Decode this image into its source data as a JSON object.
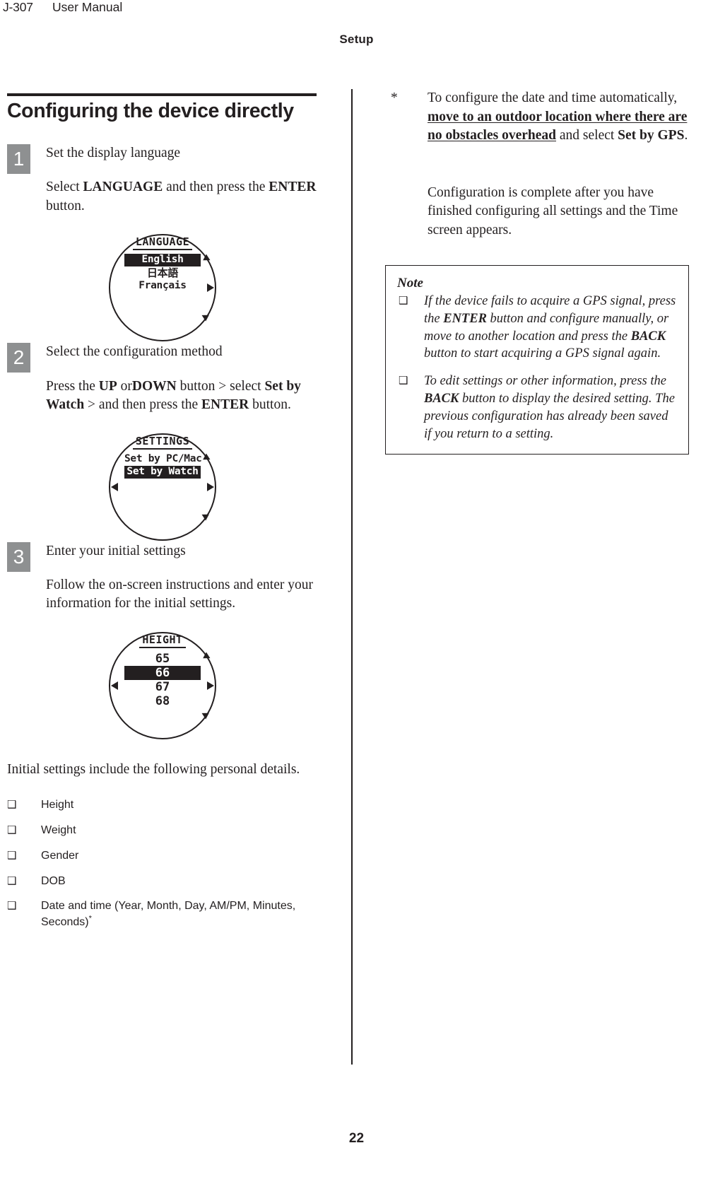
{
  "running_head": {
    "model": "J-307",
    "manual_title": "User Manual"
  },
  "section_title": "Setup",
  "page_number": "22",
  "left_column": {
    "headline": "Configuring the device directly",
    "steps": [
      {
        "number": "1",
        "title": "Set the display language",
        "body_parts": [
          {
            "text": "Select ",
            "style": "normal"
          },
          {
            "text": "LANGUAGE",
            "style": "bold"
          },
          {
            "text": " and then press the ",
            "style": "normal"
          },
          {
            "text": "ENTER",
            "style": "bold"
          },
          {
            "text": " button.",
            "style": "normal"
          }
        ],
        "screen": {
          "name": "language-screen",
          "title": "LANGUAGE",
          "rows": [
            {
              "label": "English",
              "selected": true,
              "script": "latin"
            },
            {
              "label": "日本語",
              "selected": false,
              "script": "cjk"
            },
            {
              "label": "Français",
              "selected": false,
              "script": "latin"
            }
          ],
          "arrows": [
            "top-right",
            "right",
            "bottom-right"
          ]
        }
      },
      {
        "number": "2",
        "title": "Select the configuration method",
        "body_parts": [
          {
            "text": "Press the ",
            "style": "normal"
          },
          {
            "text": "UP",
            "style": "bold"
          },
          {
            "text": " or",
            "style": "normal"
          },
          {
            "text": "DOWN",
            "style": "bold"
          },
          {
            "text": " button > select ",
            "style": "normal"
          },
          {
            "text": "Set by Watch",
            "style": "bold"
          },
          {
            "text": " > and then press the ",
            "style": "normal"
          },
          {
            "text": "ENTER",
            "style": "bold"
          },
          {
            "text": " button.",
            "style": "normal"
          }
        ],
        "screen": {
          "name": "settings-screen",
          "title": "SETTINGS",
          "rows": [
            {
              "label": "Set by PC/Mac",
              "selected": false,
              "script": "latin"
            },
            {
              "label": "Set by Watch",
              "selected": true,
              "script": "latin"
            }
          ],
          "arrows": [
            "top-right",
            "right",
            "left",
            "bottom-right"
          ]
        }
      },
      {
        "number": "3",
        "title": "Enter your initial settings",
        "body_parts": [
          {
            "text": "Follow the on-screen instructions and enter your information for the initial settings.",
            "style": "normal"
          }
        ],
        "screen": {
          "name": "height-screen",
          "title": "HEIGHT",
          "rows": [
            {
              "label": "65",
              "selected": false,
              "script": "num"
            },
            {
              "label": "66",
              "selected": true,
              "script": "num"
            },
            {
              "label": "67",
              "selected": false,
              "script": "num"
            },
            {
              "label": "68",
              "selected": false,
              "script": "num"
            }
          ],
          "arrows": [
            "top-right",
            "right",
            "left",
            "bottom-right"
          ]
        }
      }
    ],
    "closing_paragraph": "Initial settings include the following personal details.",
    "details_list": [
      {
        "bullet": "❑",
        "label": "Height",
        "superscript": ""
      },
      {
        "bullet": "❑",
        "label": "Weight",
        "superscript": ""
      },
      {
        "bullet": "❑",
        "label": "Gender",
        "superscript": ""
      },
      {
        "bullet": "❑",
        "label": "DOB",
        "superscript": ""
      },
      {
        "bullet": "❑",
        "label": "Date and time (Year, Month, Day, AM/PM, Minutes, Seconds)",
        "superscript": "*"
      }
    ]
  },
  "right_column": {
    "footnote": {
      "marker": "*",
      "parts": [
        {
          "text": "To configure the date and time automatically, ",
          "style": "normal"
        },
        {
          "text": "move to an outdoor location where there are no obstacles overhead",
          "style": "bold-underline"
        },
        {
          "text": " and select ",
          "style": "normal"
        },
        {
          "text": "Set by GPS",
          "style": "bold"
        },
        {
          "text": ".",
          "style": "normal"
        }
      ]
    },
    "completion_paragraph": "Configuration is complete after you have finished configuring all settings and the Time screen appears.",
    "note": {
      "title": "Note",
      "items": [
        {
          "bullet": "❑",
          "parts": [
            {
              "text": "If the device fails to acquire a GPS signal, press the ",
              "style": "normal"
            },
            {
              "text": "ENTER",
              "style": "bold"
            },
            {
              "text": " button and configure manually, or move to another location and press the ",
              "style": "normal"
            },
            {
              "text": "BACK",
              "style": "bold"
            },
            {
              "text": " button to start acquiring a GPS signal again.",
              "style": "normal"
            }
          ]
        },
        {
          "bullet": "❑",
          "parts": [
            {
              "text": "To edit settings or other information, press the ",
              "style": "normal"
            },
            {
              "text": "BACK",
              "style": "bold"
            },
            {
              "text": " button to display the desired setting. The previous configuration has already been saved if you return to a setting.",
              "style": "normal"
            }
          ]
        }
      ]
    }
  },
  "colors": {
    "text": "#231f20",
    "step_badge_bg": "#8e9091",
    "screen_selected_bg": "#231f20",
    "page_bg": "#ffffff"
  }
}
